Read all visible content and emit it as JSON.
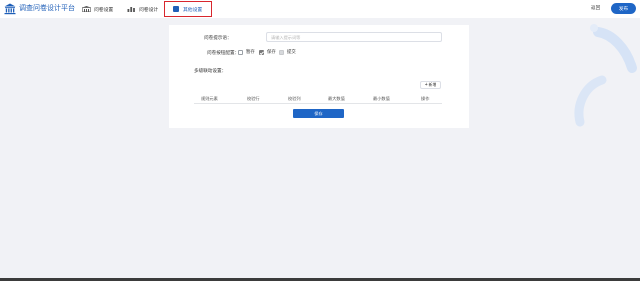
{
  "header": {
    "app_title": "调查问卷设计平台",
    "nav": [
      {
        "label": "问卷设置",
        "icon": "building-icon"
      },
      {
        "label": "问卷设计",
        "icon": "chart-icon"
      },
      {
        "label": "其他设置",
        "icon": "settings-square-icon",
        "active": true
      }
    ],
    "back_label": "返回",
    "publish_label": "发布"
  },
  "settings": {
    "prompt_label": "问卷提示语：",
    "prompt_placeholder": "请输入提示词等",
    "check_label": "问卷按钮配置：",
    "checkboxes": [
      {
        "label": "暂存",
        "checked": false
      },
      {
        "label": "保存",
        "checked": true
      },
      {
        "label": "提交",
        "checked": false
      }
    ],
    "section_label": "多级联动设置：",
    "add_label": "新增",
    "table_headers": [
      "规则元素",
      "校验行",
      "校验列",
      "最大数值",
      "最小数值",
      "操作"
    ],
    "save_label": "保存"
  },
  "colors": {
    "accent": "#1f66c6",
    "active_border": "#d8262d"
  }
}
